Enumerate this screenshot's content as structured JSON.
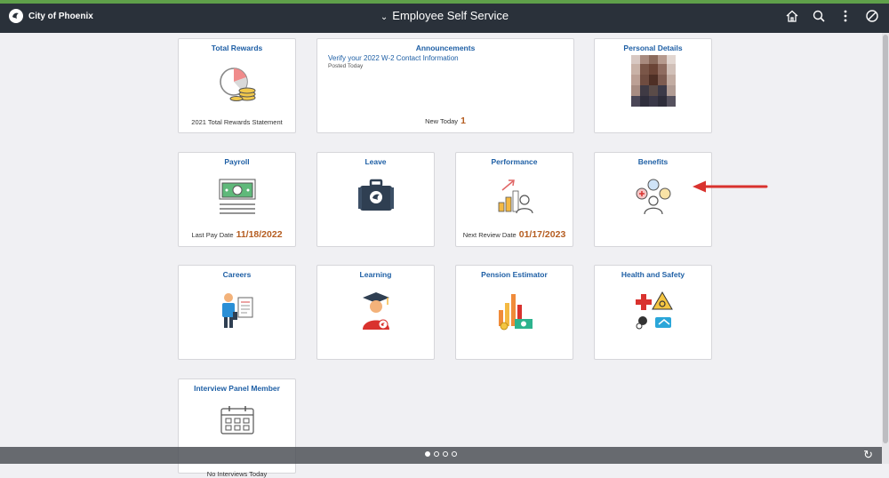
{
  "header": {
    "brand": "City of Phoenix",
    "title": "Employee Self Service",
    "icons": [
      "home-icon",
      "search-icon",
      "more-icon",
      "cancel-icon"
    ]
  },
  "tiles": {
    "total_rewards": {
      "title": "Total Rewards",
      "footer": "2021 Total Rewards Statement"
    },
    "announcements": {
      "title": "Announcements",
      "link": "Verify your 2022 W-2 Contact Information",
      "posted": "Posted Today",
      "footer": "New Today",
      "count": "1"
    },
    "personal_details": {
      "title": "Personal Details"
    },
    "payroll": {
      "title": "Payroll",
      "footer_label": "Last Pay Date",
      "footer_value": "11/18/2022"
    },
    "leave": {
      "title": "Leave"
    },
    "performance": {
      "title": "Performance",
      "footer_label": "Next Review Date",
      "footer_value": "01/17/2023"
    },
    "benefits": {
      "title": "Benefits"
    },
    "careers": {
      "title": "Careers"
    },
    "learning": {
      "title": "Learning"
    },
    "pension": {
      "title": "Pension Estimator"
    },
    "health": {
      "title": "Health and Safety"
    },
    "interview": {
      "title": "Interview Panel Member",
      "footer": "No Interviews Today"
    }
  },
  "pager": {
    "pages": 4,
    "active": 1
  },
  "colors": {
    "accent": "#1e5fa5",
    "highlight": "#b55d21",
    "topbar": "#2a313a",
    "arrow": "#d9322e"
  }
}
